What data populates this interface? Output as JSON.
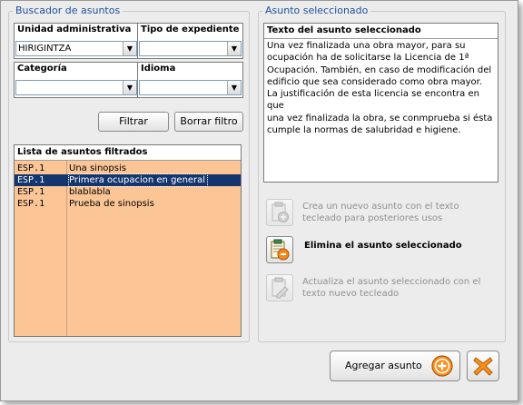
{
  "search_group": {
    "title": "Buscador de asuntos",
    "unidad": {
      "label": "Unidad administrativa",
      "value": "HIRIGINTZA"
    },
    "tipo": {
      "label": "Tipo de expediente",
      "value": ""
    },
    "categoria": {
      "label": "Categoría",
      "value": ""
    },
    "idioma": {
      "label": "Idioma",
      "value": ""
    },
    "filter_button": "Filtrar",
    "clear_button": "Borrar filtro",
    "list": {
      "header": "Lista de asuntos filtrados",
      "rows": [
        {
          "code": "ESP.1",
          "name": "Una sinopsis",
          "selected": false
        },
        {
          "code": "ESP.1",
          "name": "Primera ocupacion en general",
          "selected": true
        },
        {
          "code": "ESP.1",
          "name": "blablabla",
          "selected": false
        },
        {
          "code": "ESP.1",
          "name": "Prueba de sinopsis",
          "selected": false
        }
      ]
    }
  },
  "selected_group": {
    "title": "Asunto seleccionado",
    "text_header": "Texto del asunto seleccionado",
    "text_lines": [
      "Una vez finalizada una obra mayor, para su",
      "ocupación ha de solicitarse la Licencia de 1ª",
      "Ocupación. También, en caso de modificación del",
      "edificio que sea considerado como obra mayor.",
      "La justificación de esta licencia se encontra en que",
      "una vez finalizada la obra, se conmprueba si ésta",
      "cumple la normas de salubridad e higiene."
    ],
    "actions": {
      "create": [
        "Crea un nuevo asunto con el texto",
        "tecleado para posteriores usos"
      ],
      "delete": "Elimina el asunto seleccionado",
      "update": [
        "Actualiza el asunto seleccionado con el",
        "texto nuevo tecleado"
      ]
    }
  },
  "footer": {
    "add_button": "Agregar asunto"
  },
  "colors": {
    "group_title": "#1d4f9c",
    "list_background": "#fbc595",
    "selected_row": "#13366f"
  }
}
